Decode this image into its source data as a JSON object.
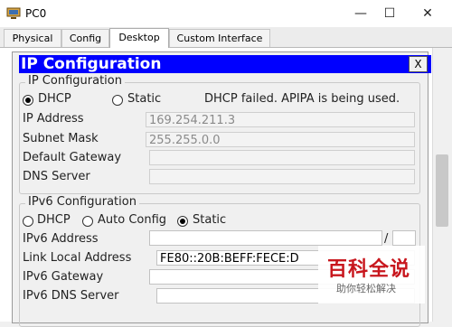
{
  "window": {
    "title": "PC0",
    "minimize_glyph": "—",
    "maximize_glyph": "☐",
    "close_glyph": "✕"
  },
  "tabs": [
    {
      "label": "Physical",
      "active": false
    },
    {
      "label": "Config",
      "active": false
    },
    {
      "label": "Desktop",
      "active": true
    },
    {
      "label": "Custom Interface",
      "active": false
    }
  ],
  "dialog": {
    "title": "IP Configuration",
    "close_label": "X",
    "ipv4": {
      "legend": "IP Configuration",
      "dhcp_label": "DHCP",
      "static_label": "Static",
      "selected": "DHCP",
      "status": "DHCP failed. APIPA is being used.",
      "ip_address_label": "IP Address",
      "ip_address_value": "169.254.211.3",
      "subnet_mask_label": "Subnet Mask",
      "subnet_mask_value": "255.255.0.0",
      "default_gateway_label": "Default Gateway",
      "default_gateway_value": "",
      "dns_server_label": "DNS Server",
      "dns_server_value": ""
    },
    "ipv6": {
      "legend": "IPv6 Configuration",
      "dhcp_label": "DHCP",
      "auto_config_label": "Auto Config",
      "static_label": "Static",
      "selected": "Static",
      "ipv6_address_label": "IPv6 Address",
      "ipv6_address_value": "",
      "prefix_separator": "/",
      "prefix_value": "",
      "link_local_label": "Link Local Address",
      "link_local_value": "FE80::20B:BEFF:FECE:D",
      "ipv6_gateway_label": "IPv6 Gateway",
      "ipv6_gateway_value": "",
      "ipv6_dns_label": "IPv6 DNS Server",
      "ipv6_dns_value": ""
    }
  },
  "watermark": {
    "title": "百科全说",
    "subtitle": "助你轻松解决"
  }
}
